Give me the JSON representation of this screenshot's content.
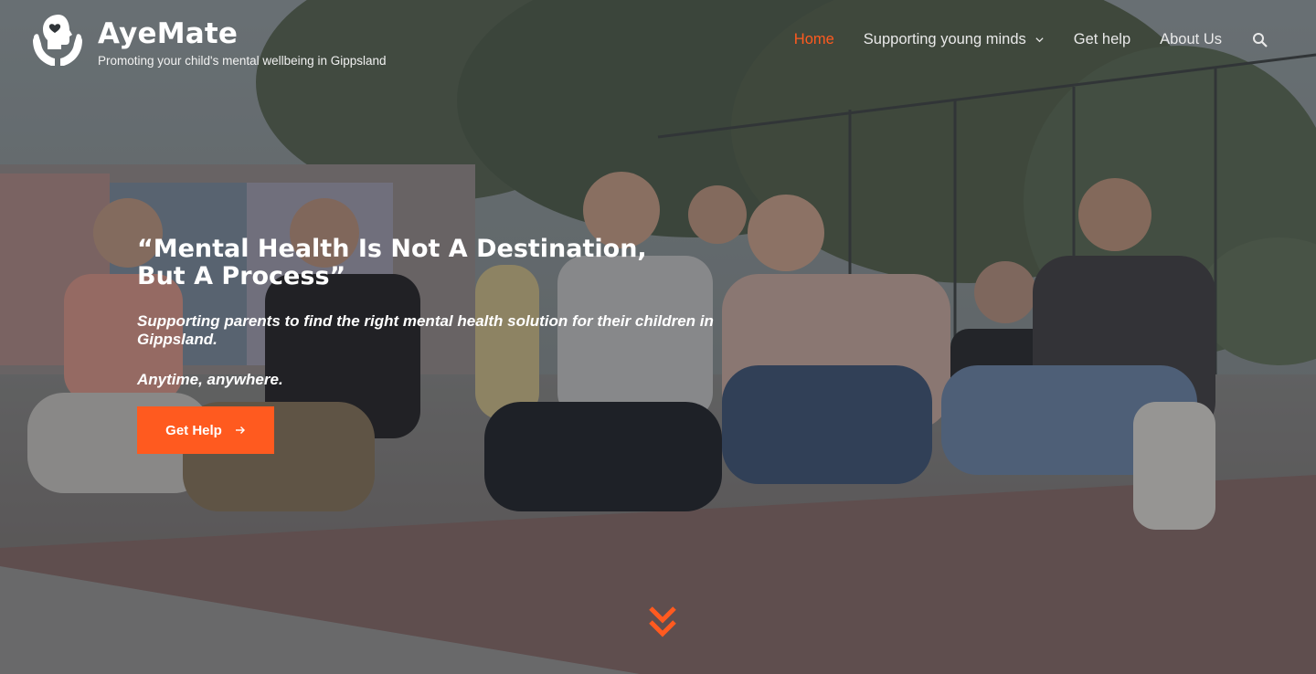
{
  "brand": {
    "logo_icon": "hands-holding-head-icon",
    "title": "AyeMate",
    "tagline": "Promoting your child's mental wellbeing in Gippsland"
  },
  "nav": {
    "items": [
      {
        "label": "Home",
        "active": true
      },
      {
        "label": "Supporting young minds",
        "has_dropdown": true
      },
      {
        "label": "Get help"
      },
      {
        "label": "About Us"
      }
    ],
    "search_icon": "search-icon"
  },
  "hero": {
    "headline": "“Mental Health Is Not A Destination, But A Process”",
    "subline": "Supporting parents to find the right mental health solution for their children in Gippsland.",
    "subline2": "Anytime, anywhere.",
    "cta_label": "Get Help",
    "cta_icon": "arrow-right-icon",
    "scroll_icon": "double-chevron-down-icon",
    "background_image": "photo of teenagers sitting on the ground at a skate park"
  },
  "colors": {
    "accent": "#ff5a1f",
    "text": "#ffffff",
    "overlay": "rgba(36,40,46,0.42)"
  }
}
